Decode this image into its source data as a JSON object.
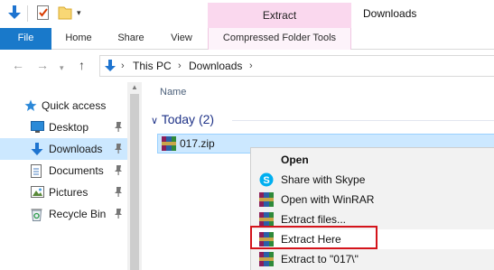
{
  "quick_access_toolbar": {
    "icons": [
      "download-arrow-icon",
      "properties-checklist-icon",
      "new-folder-icon",
      "customize-dropdown-icon"
    ]
  },
  "window": {
    "title": "Downloads"
  },
  "ribbon": {
    "contextual_header": "Extract",
    "tabs": [
      "File",
      "Home",
      "Share",
      "View",
      "Compressed Folder Tools"
    ]
  },
  "address_bar": {
    "breadcrumbs": [
      "This PC",
      "Downloads"
    ]
  },
  "nav_pane": {
    "quick_access_label": "Quick access",
    "items": [
      {
        "label": "Desktop",
        "icon": "desktop-icon",
        "pinned": true,
        "selected": false
      },
      {
        "label": "Downloads",
        "icon": "downloads-icon",
        "pinned": true,
        "selected": true
      },
      {
        "label": "Documents",
        "icon": "documents-icon",
        "pinned": true,
        "selected": false
      },
      {
        "label": "Pictures",
        "icon": "pictures-icon",
        "pinned": true,
        "selected": false
      },
      {
        "label": "Recycle Bin",
        "icon": "recycle-bin-icon",
        "pinned": true,
        "selected": false
      }
    ]
  },
  "file_list": {
    "column_header": "Name",
    "group_header": "Today (2)",
    "files": [
      {
        "name": "017.zip",
        "icon": "winrar-archive-icon",
        "selected": true
      }
    ]
  },
  "context_menu": {
    "items": [
      {
        "label": "Open",
        "icon": "",
        "bold": true
      },
      {
        "label": "Share with Skype",
        "icon": "skype-icon"
      },
      {
        "label": "Open with WinRAR",
        "icon": "winrar-icon"
      },
      {
        "label": "Extract files...",
        "icon": "winrar-icon"
      },
      {
        "label": "Extract Here",
        "icon": "winrar-icon",
        "highlighted": true
      },
      {
        "label": "Extract to \"017\\\"",
        "icon": "winrar-icon"
      }
    ]
  },
  "colors": {
    "file_tab": "#1979ca",
    "contextual_tab": "#fad8ee",
    "selection": "#cce8ff",
    "highlight_box": "#d4141b",
    "group_header": "#1e3287"
  }
}
